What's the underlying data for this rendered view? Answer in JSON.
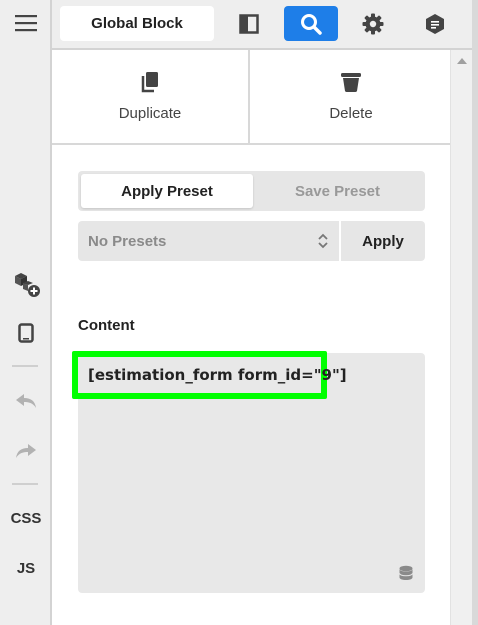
{
  "topbar": {
    "title": "Global Block",
    "buttons": [
      {
        "name": "panel-toggle",
        "icon": "sidebar-panel-icon",
        "active": false
      },
      {
        "name": "search",
        "icon": "search-icon",
        "active": true
      },
      {
        "name": "settings",
        "icon": "gear-icon",
        "active": false
      },
      {
        "name": "content-info",
        "icon": "hexagon-doc-icon",
        "active": false
      }
    ],
    "accent_color": "#1e7ee8"
  },
  "leftbar": {
    "items": [
      {
        "name": "menu",
        "icon": "hamburger-icon"
      },
      {
        "name": "add-element",
        "icon": "cubes-plus-icon"
      },
      {
        "name": "device-preview",
        "icon": "tablet-icon"
      },
      {
        "name": "undo",
        "icon": "undo-icon"
      },
      {
        "name": "redo",
        "icon": "redo-icon"
      }
    ],
    "css_label": "CSS",
    "js_label": "JS"
  },
  "actions": {
    "duplicate_label": "Duplicate",
    "delete_label": "Delete"
  },
  "presets": {
    "apply_tab": "Apply Preset",
    "save_tab": "Save Preset",
    "select_value": "No Presets",
    "apply_button": "Apply"
  },
  "content": {
    "label": "Content",
    "value": "[estimation_form form_id=\"9\"]",
    "highlight_color": "#00ff00"
  }
}
